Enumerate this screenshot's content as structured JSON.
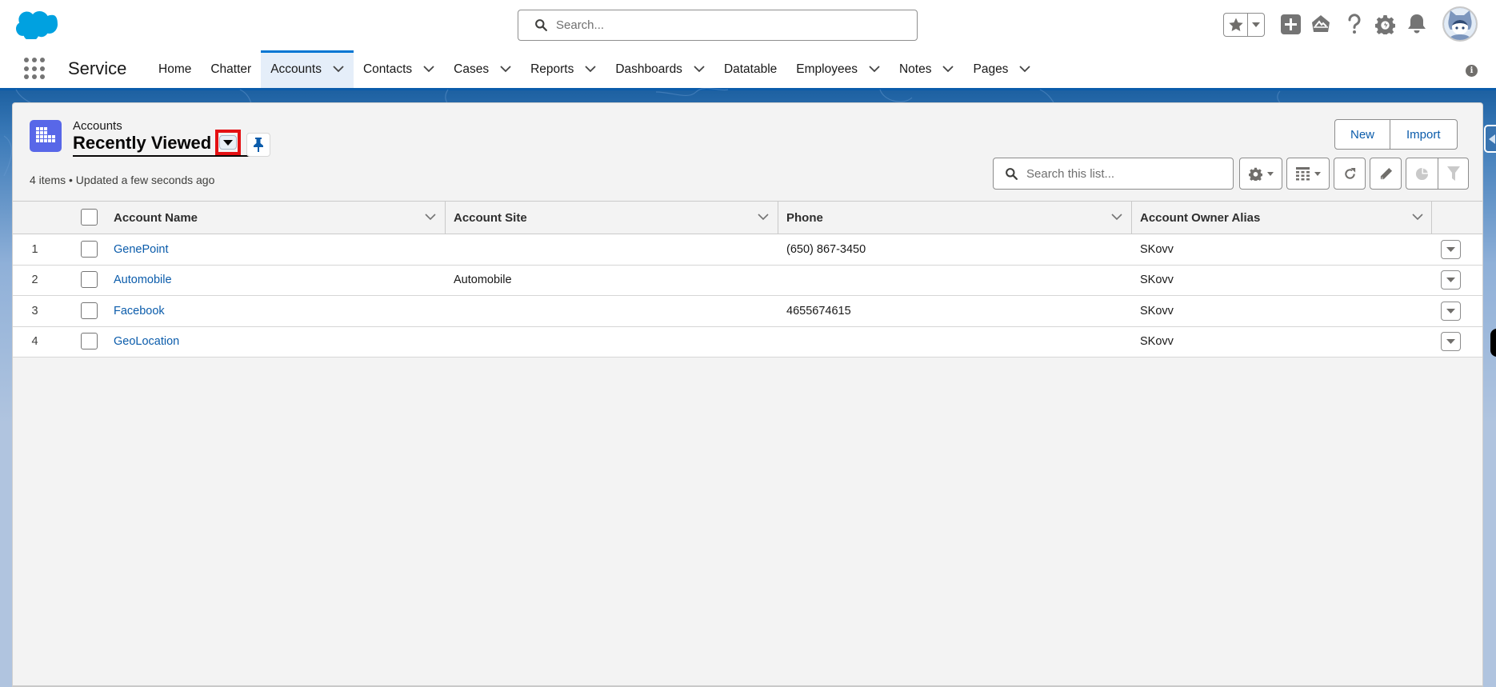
{
  "header": {
    "search_placeholder": "Search...",
    "icons": [
      "salesforce-cloud-logo",
      "favorites-star-icon",
      "favorites-dropdown-icon",
      "global-create-plus-icon",
      "trailhead-icon",
      "help-icon",
      "setup-gear-icon",
      "notifications-bell-icon",
      "user-avatar"
    ]
  },
  "nav": {
    "app_name": "Service",
    "items": [
      {
        "label": "Home",
        "has_menu": false,
        "active": false
      },
      {
        "label": "Chatter",
        "has_menu": false,
        "active": false
      },
      {
        "label": "Accounts",
        "has_menu": true,
        "active": true
      },
      {
        "label": "Contacts",
        "has_menu": true,
        "active": false
      },
      {
        "label": "Cases",
        "has_menu": true,
        "active": false
      },
      {
        "label": "Reports",
        "has_menu": true,
        "active": false
      },
      {
        "label": "Dashboards",
        "has_menu": true,
        "active": false
      },
      {
        "label": "Datatable",
        "has_menu": false,
        "active": false
      },
      {
        "label": "Employees",
        "has_menu": true,
        "active": false
      },
      {
        "label": "Notes",
        "has_menu": true,
        "active": false
      },
      {
        "label": "Pages",
        "has_menu": true,
        "active": false
      }
    ],
    "info_icon": "i"
  },
  "list_view": {
    "object_label": "Accounts",
    "title": "Recently Viewed",
    "meta": "4 items • Updated a few seconds ago",
    "buttons": {
      "new": "New",
      "import": "Import"
    },
    "search_placeholder": "Search this list...",
    "highlight_color": "#e41013"
  },
  "table": {
    "columns": [
      "Account Name",
      "Account Site",
      "Phone",
      "Account Owner Alias"
    ],
    "rows": [
      {
        "num": "1",
        "name": "GenePoint",
        "site": "",
        "phone": "(650) 867-3450",
        "owner": "SKovv"
      },
      {
        "num": "2",
        "name": "Automobile",
        "site": "Automobile",
        "phone": "",
        "owner": "SKovv"
      },
      {
        "num": "3",
        "name": "Facebook",
        "site": "",
        "phone": "4655674615",
        "owner": "SKovv"
      },
      {
        "num": "4",
        "name": "GeoLocation",
        "site": "",
        "phone": "",
        "owner": "SKovv"
      }
    ]
  },
  "colors": {
    "brand_blue": "#0176d3",
    "link_blue": "#0b5cab",
    "object_icon": "#5867e8"
  }
}
